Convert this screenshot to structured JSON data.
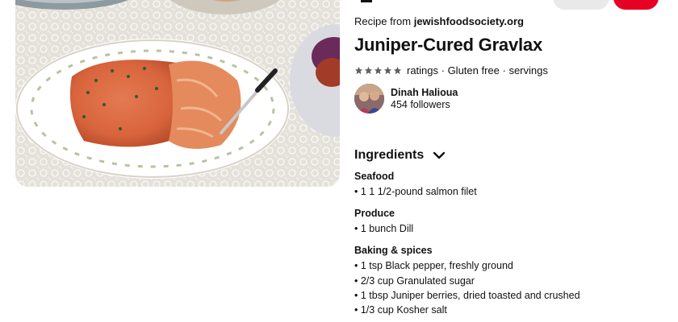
{
  "recipe": {
    "source_prefix": "Recipe from ",
    "source_domain": "jewishfoodsociety.org",
    "title": "Juniper-Cured Gravlax",
    "meta_text": "ratings · Gluten free · servings",
    "rating_stars": 5
  },
  "author": {
    "name": "Dinah Halioua",
    "followers": "454 followers"
  },
  "ingredients": {
    "header": "Ingredients",
    "groups": [
      {
        "title": "Seafood",
        "items": [
          "• 1 1 1/2-pound salmon filet"
        ]
      },
      {
        "title": "Produce",
        "items": [
          "• 1 bunch Dill"
        ]
      },
      {
        "title": "Baking & spices",
        "items": [
          "• 1 tsp Black pepper, freshly ground",
          "• 2/3 cup Granulated sugar",
          "• 1 tbsp Juniper berries, dried toasted and crushed",
          "• 1/3 cup Kosher salt"
        ]
      }
    ]
  },
  "colors": {
    "accent_red": "#e60023",
    "pill_gray": "#e9e9e9",
    "text": "#111111"
  },
  "icons": {
    "rating": "star-icon",
    "expand": "chevron-down-icon"
  }
}
